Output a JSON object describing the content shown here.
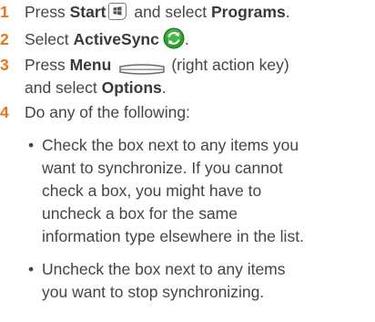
{
  "steps": [
    {
      "number": "1",
      "parts": {
        "a": "Press ",
        "b": "Start",
        "c": " and select ",
        "d": "Programs",
        "e": "."
      }
    },
    {
      "number": "2",
      "parts": {
        "a": "Select ",
        "b": "ActiveSync",
        "c": "."
      }
    },
    {
      "number": "3",
      "parts": {
        "a": "Press ",
        "b": "Menu",
        "c": "(right action key)",
        "d": "and select ",
        "e": "Options",
        "f": "."
      }
    },
    {
      "number": "4",
      "text": "Do any of the following:",
      "bullets": [
        {
          "lines": [
            "Check the box next to any items you",
            "want to synchronize. If you cannot",
            "check a box, you might have to",
            "uncheck a box for the same",
            "information type elsewhere in the list."
          ]
        },
        {
          "lines": [
            "Uncheck the box next to any items",
            "you want to stop synchronizing."
          ]
        }
      ]
    }
  ],
  "bullet_glyph": "•",
  "colors": {
    "step_number": "#e8731a",
    "body_text": "#454545",
    "sync_icon_green": "#2e9e2e"
  },
  "icons": [
    "start-menu-icon",
    "activesync-icon",
    "right-action-key-icon"
  ]
}
